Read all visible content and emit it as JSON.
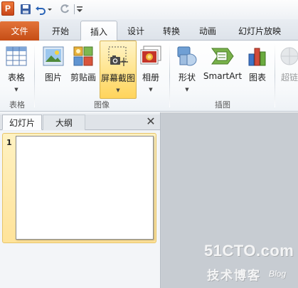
{
  "app": {
    "logo_letter": "P"
  },
  "tabs": [
    {
      "label": "文件"
    },
    {
      "label": "开始"
    },
    {
      "label": "插入"
    },
    {
      "label": "设计"
    },
    {
      "label": "转换"
    },
    {
      "label": "动画"
    },
    {
      "label": "幻灯片放映"
    }
  ],
  "ribbon": {
    "buttons": {
      "table": "表格",
      "picture": "图片",
      "clipart": "剪贴画",
      "screenshot": "屏幕截图",
      "album": "相册",
      "shapes": "形状",
      "smartart": "SmartArt",
      "chart": "图表",
      "hyperlink": "超链"
    },
    "groups": {
      "tables": "表格",
      "images": "图像",
      "illustrations": "插图"
    }
  },
  "panel": {
    "tab_slides": "幻灯片",
    "tab_outline": "大纲",
    "close_glyph": "✕",
    "slide_number": "1"
  },
  "watermark": {
    "site": "51CTO.com",
    "sub": "技术博客",
    "blog": "Blog"
  },
  "colors": {
    "file_tab": "#d35a1f",
    "highlight": "#ffe38a",
    "workspace": "#c8cdd3"
  }
}
